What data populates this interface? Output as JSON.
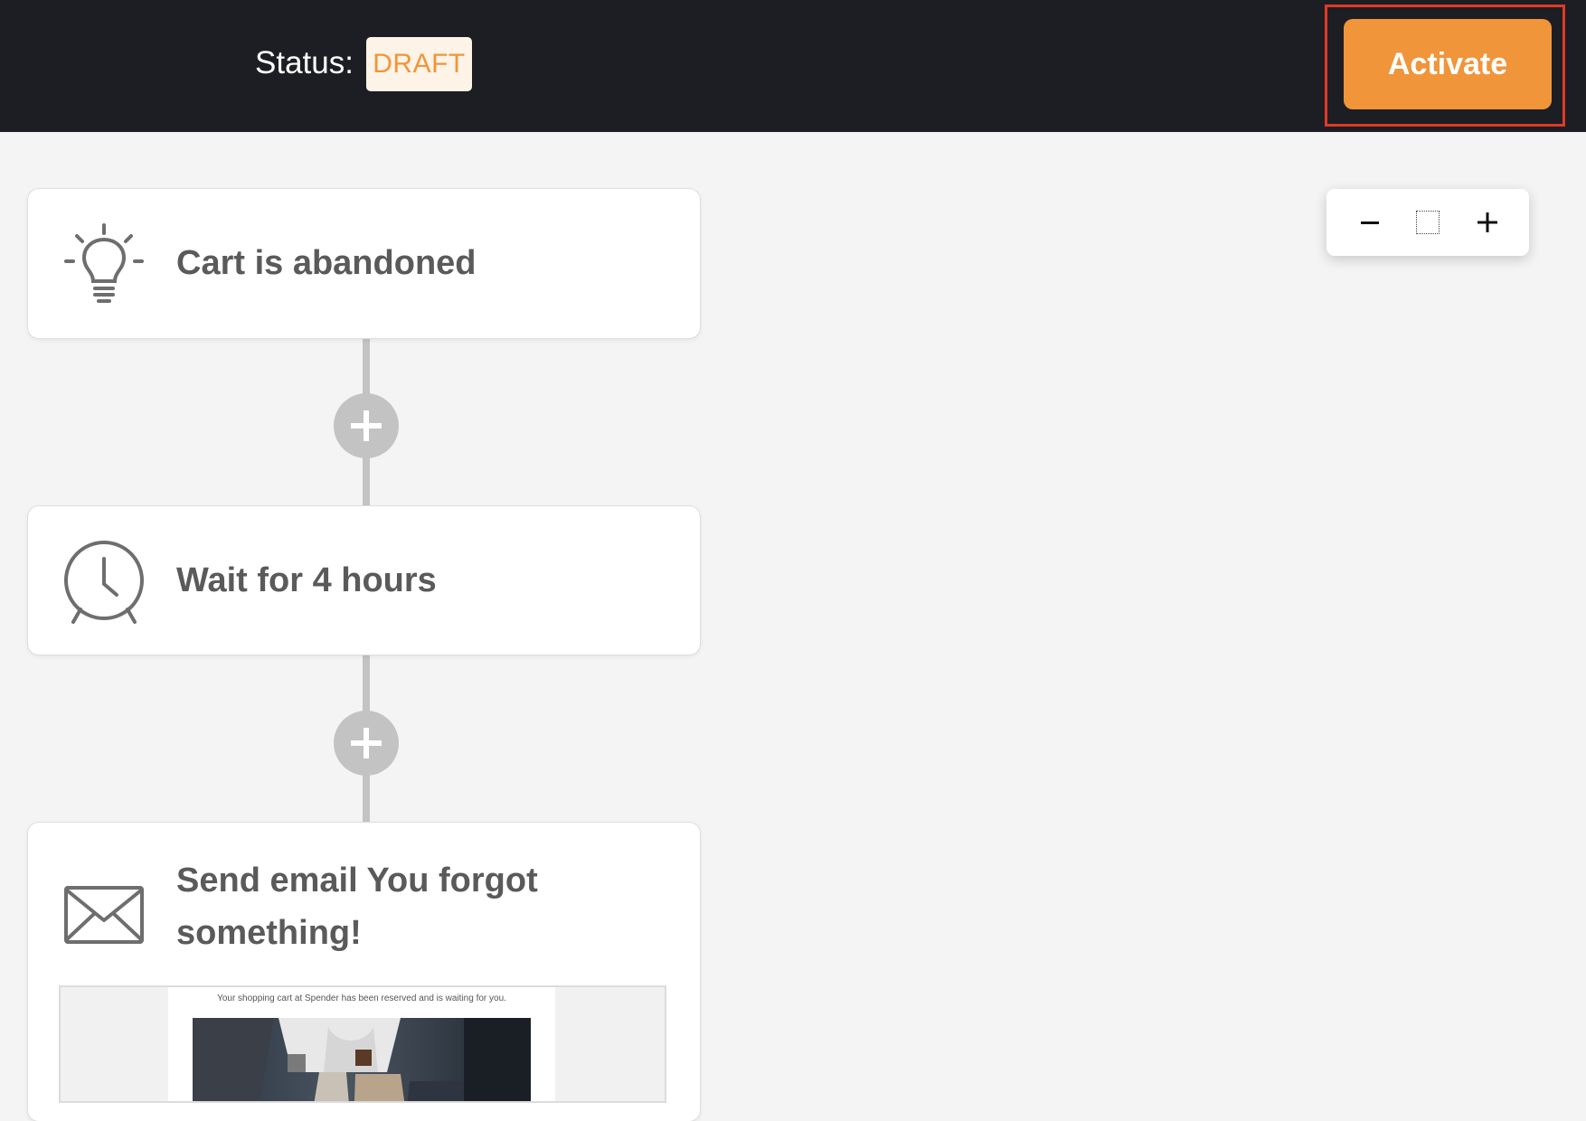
{
  "header": {
    "status_label": "Status:",
    "status_value": "DRAFT",
    "activate_label": "Activate"
  },
  "zoom_controls": {
    "zoom_out": "−",
    "zoom_in": "+"
  },
  "workflow": {
    "steps": [
      {
        "icon": "lightbulb-icon",
        "title": "Cart is abandoned"
      },
      {
        "icon": "alarm-clock-icon",
        "title": "Wait for 4 hours"
      },
      {
        "icon": "envelope-icon",
        "title": "Send email You forgot something!",
        "preview_text": "Your shopping cart at Spender has been reserved and is waiting for you."
      }
    ]
  },
  "colors": {
    "header_bg": "#1d1e23",
    "accent": "#f0953a",
    "badge_bg": "#fdf3e6",
    "highlight_border": "#e03a26",
    "canvas_bg": "#f4f4f4",
    "connector": "#c3c3c3",
    "card_title": "#5a5a5a"
  }
}
